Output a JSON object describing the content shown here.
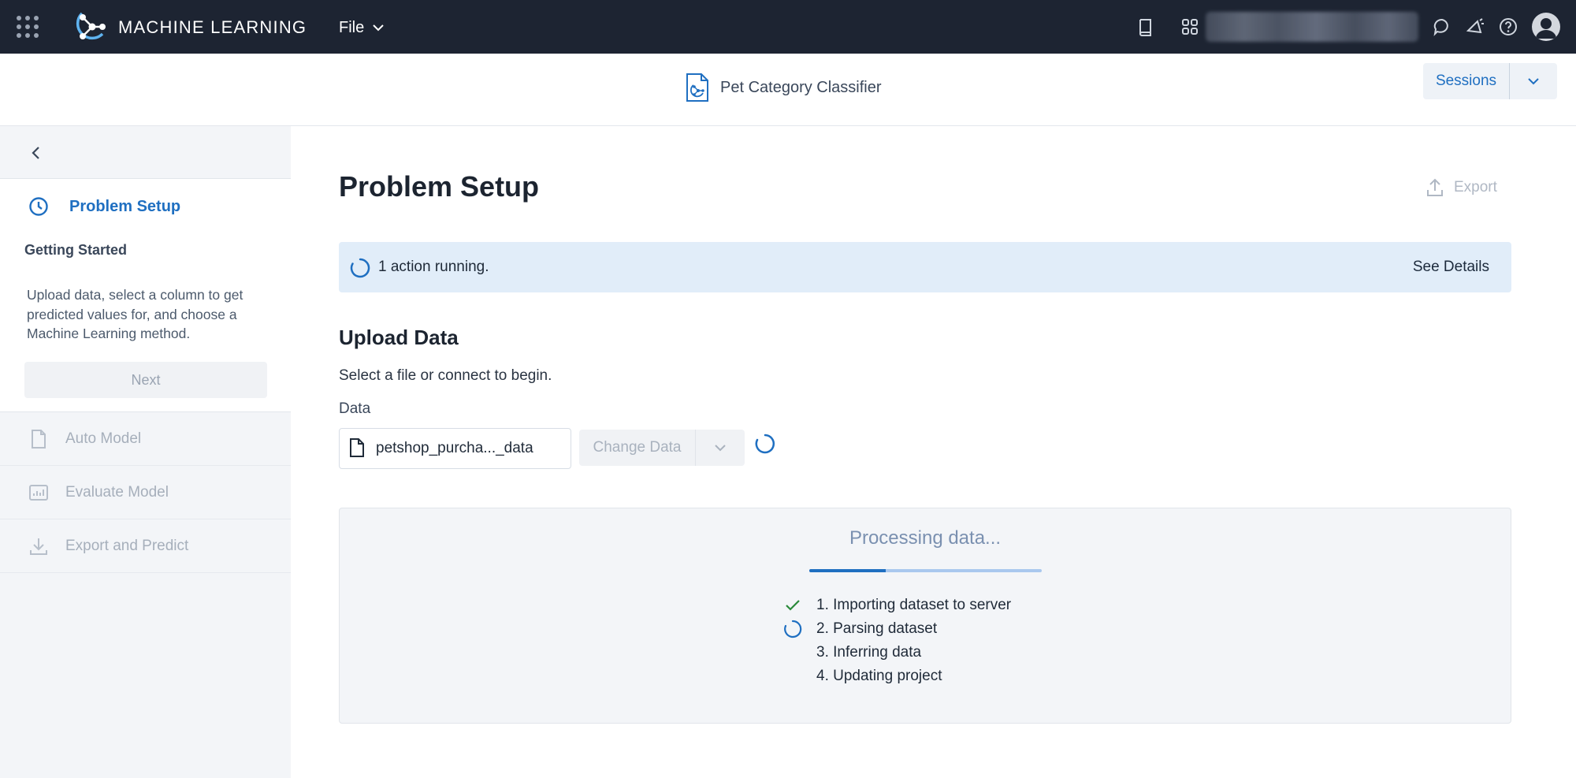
{
  "topbar": {
    "app_name": "MACHINE LEARNING",
    "file_menu_label": "File",
    "icons": [
      "apps-grid-icon",
      "book-icon",
      "grid-icon",
      "chat-icon",
      "announcement-icon",
      "help-icon",
      "user-avatar-icon"
    ]
  },
  "document": {
    "title": "Pet Category Classifier",
    "sessions_label": "Sessions"
  },
  "sidebar": {
    "active_step": {
      "label": "Problem Setup",
      "section": "Getting Started",
      "description": "Upload data, select a column to get predicted values for, and choose a Machine Learning method.",
      "next_label": "Next"
    },
    "steps": [
      {
        "label": "Auto Model",
        "icon": "document-icon"
      },
      {
        "label": "Evaluate Model",
        "icon": "chart-icon"
      },
      {
        "label": "Export and Predict",
        "icon": "download-icon"
      }
    ]
  },
  "main": {
    "title": "Problem Setup",
    "export_label": "Export",
    "banner": {
      "text": "1 action running.",
      "link": "See Details"
    },
    "upload": {
      "title": "Upload Data",
      "subtitle": "Select a file or connect to begin.",
      "data_label": "Data",
      "file_name": "petshop_purcha..._data",
      "change_data_label": "Change Data"
    },
    "processing": {
      "title": "Processing data...",
      "progress": 0.33,
      "steps": [
        {
          "label": "1. Importing dataset to server",
          "status": "done"
        },
        {
          "label": "2. Parsing dataset",
          "status": "running"
        },
        {
          "label": "3. Inferring data",
          "status": "pending"
        },
        {
          "label": "4. Updating project",
          "status": "pending"
        }
      ]
    }
  },
  "colors": {
    "accent": "#1f6fc1",
    "topbar_bg": "#1d2432",
    "banner_bg": "#e1edf9",
    "success": "#2a8a3a"
  }
}
